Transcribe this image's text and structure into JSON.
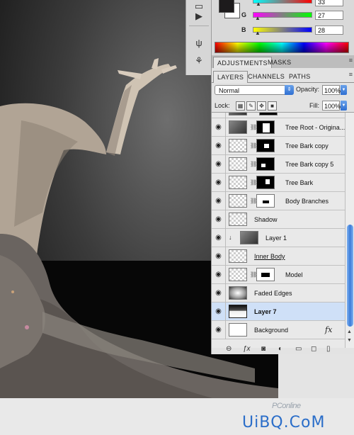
{
  "color_panel": {
    "channels": [
      {
        "label": "",
        "value": "33",
        "slider_from": "#00ffff",
        "slider_to": "#ff0000"
      },
      {
        "label": "G",
        "value": "27",
        "slider_from": "#ff00ff",
        "slider_to": "#00ff00"
      },
      {
        "label": "B",
        "value": "28",
        "slider_from": "#ffff00",
        "slider_to": "#0000ff"
      }
    ],
    "foreground": "#1d1b1c",
    "background": "#ffffff"
  },
  "adjustments": {
    "tabs": [
      "ADJUSTMENTS",
      "MASKS"
    ]
  },
  "layers_panel": {
    "tabs": [
      "LAYERS",
      "CHANNELS",
      "PATHS"
    ],
    "blend_mode": "Normal",
    "opacity_label": "Opacity:",
    "opacity": "100%",
    "lock_label": "Lock:",
    "fill_label": "Fill:",
    "fill": "100%",
    "layers": [
      {
        "name": "",
        "thumb": "tree"
      },
      {
        "name": "Tree Root - Origina...",
        "thumb": "tree"
      },
      {
        "name": "Tree Bark copy",
        "thumb": "trans"
      },
      {
        "name": "Tree Bark copy 5",
        "thumb": "trans"
      },
      {
        "name": "Tree Bark",
        "thumb": "trans"
      },
      {
        "name": "Body Branches",
        "thumb": "trans"
      },
      {
        "name": "Shadow",
        "thumb": "trans"
      },
      {
        "name": "Layer 1",
        "thumb": "tree"
      },
      {
        "name": "Inner Body",
        "thumb": "trans"
      },
      {
        "name": "Model",
        "thumb": "trans"
      },
      {
        "name": "Faded Edges",
        "thumb": "fade"
      },
      {
        "name": "Layer 7",
        "thumb": "l7"
      },
      {
        "name": "Background",
        "thumb": "white"
      }
    ],
    "selected_layer": "Layer 7",
    "background_fx": "fx"
  },
  "watermark": {
    "pconline": "PConline",
    "uibq": "UiBQ.CoM"
  }
}
